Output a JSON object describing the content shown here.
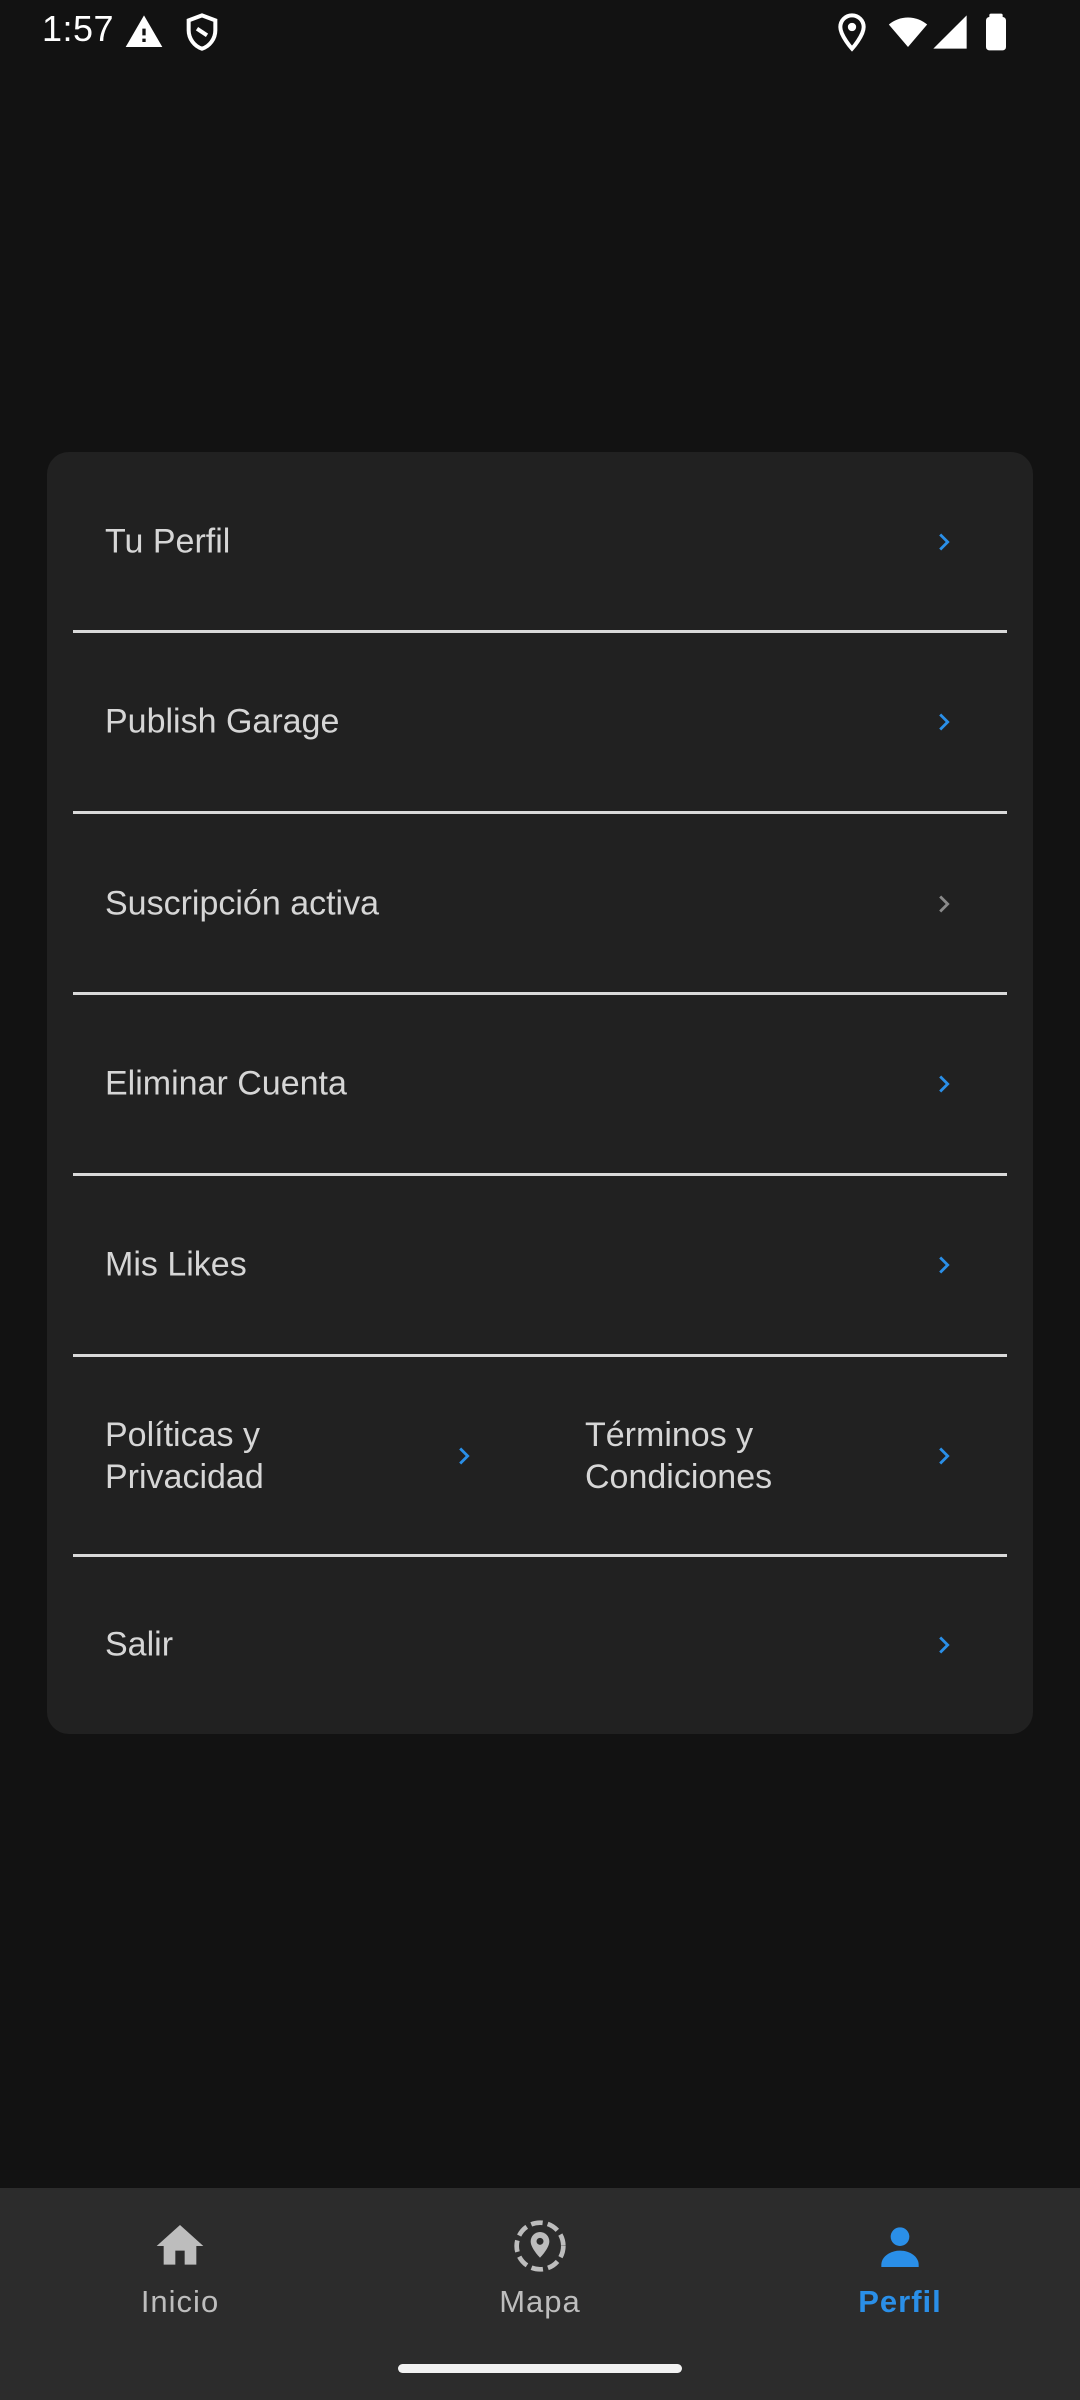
{
  "status_bar": {
    "time": "1:57",
    "icons": [
      "warning-icon",
      "shield-icon",
      "location-icon",
      "wifi-icon",
      "signal-icon",
      "battery-icon"
    ]
  },
  "menu": {
    "items": [
      {
        "label": "Tu Perfil",
        "chevron_color": "#2a8fe8"
      },
      {
        "label": "Publish Garage",
        "chevron_color": "#2a8fe8"
      },
      {
        "label": "Suscripción activa",
        "chevron_color": "#8a8a8a"
      },
      {
        "label": "Eliminar Cuenta",
        "chevron_color": "#2a8fe8"
      },
      {
        "label": "Mis Likes",
        "chevron_color": "#2a8fe8"
      }
    ],
    "split": {
      "left_label": "Políticas y Privacidad",
      "right_label": "Términos y Condiciones"
    },
    "logout_label": "Salir"
  },
  "bottom_nav": {
    "items": [
      {
        "label": "Inicio",
        "icon": "home-icon"
      },
      {
        "label": "Mapa",
        "icon": "map-pin-icon"
      },
      {
        "label": "Perfil",
        "icon": "person-icon",
        "active": true
      }
    ],
    "active_color": "#2a8fe8",
    "inactive_color": "#bdbdbd"
  },
  "colors": {
    "background": "#121212",
    "card": "#212121",
    "accent": "#2a8fe8",
    "nav_background": "#2c2c2c"
  }
}
